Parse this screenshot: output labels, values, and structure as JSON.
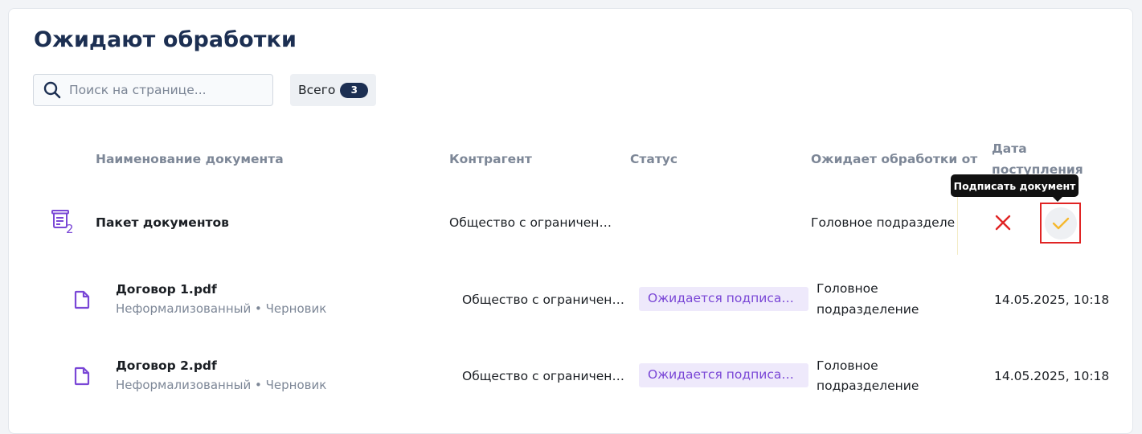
{
  "page": {
    "title": "Ожидают обработки"
  },
  "search": {
    "placeholder": "Поиск на странице..."
  },
  "total": {
    "label": "Всего",
    "count": "3"
  },
  "table": {
    "headers": {
      "name": "Наименование документа",
      "counterparty": "Контрагент",
      "status": "Статус",
      "awaiting_from": "Ожидает обработки от",
      "date_line1": "Дата",
      "date_line2": "поступления"
    },
    "package": {
      "name": "Пакет документов",
      "count": "2",
      "counterparty": "Общество с ограничен…",
      "awaiting_from": "Головное подразделе"
    },
    "rows": [
      {
        "name": "Договор 1.pdf",
        "meta": "Неформализованный • Черновик",
        "counterparty": "Общество с ограничен…",
        "status": "Ожидается подписа…",
        "awaiting_line1": "Головное",
        "awaiting_line2": "подразделение",
        "date": "14.05.2025, 10:18"
      },
      {
        "name": "Договор 2.pdf",
        "meta": "Неформализованный • Черновик",
        "counterparty": "Общество с ограничен…",
        "status": "Ожидается подписа…",
        "awaiting_line1": "Головное",
        "awaiting_line2": "подразделение",
        "date": "14.05.2025, 10:18"
      }
    ]
  },
  "actions": {
    "tooltip": "Подписать документ",
    "reject_icon": "close-icon",
    "sign_icon": "check-icon"
  },
  "colors": {
    "title": "#1c2f52",
    "accent_purple": "#7a47d6",
    "badge_bg": "#eee9fb",
    "reject": "#e02424",
    "sign": "#f5b82e",
    "highlight_border": "#e02424"
  }
}
